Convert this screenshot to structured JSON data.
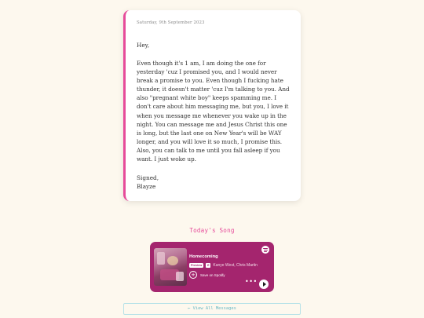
{
  "letter": {
    "date": "Saturday, 9th September 2023",
    "greeting": "Hey,",
    "body": "Even though it's 1 am, I am doing the one for yesterday 'cuz I promised you, and I would never break a promise to you. Even though I fucking hate thunder, it doesn't matter 'cuz I'm talking to you. And also \"pregnant white boy\" keeps spamming me. I don't care about him messaging me, but you, I love it when you message me whenever you wake up in the night. You can message me and Jesus Christ this one is long, but the last one on New Year's will be WAY longer, and you will love it so much, I promise this. Also, you can talk to me until you fall asleep if you want. I just woke up.",
    "signoff": "Signed,",
    "signature": "Blayze"
  },
  "song_section": {
    "heading": "Today's Song"
  },
  "spotify": {
    "track": "Homecoming",
    "preview_badge": "Preview",
    "explicit_badge": "E",
    "artists": "Kanye West, Chris Martin",
    "save_label": "Save on Spotify",
    "add_icon": "+",
    "more_icon": "•••",
    "card_color": "#a4256e"
  },
  "footer": {
    "view_all_label": "← View All Messages"
  },
  "colors": {
    "accent": "#e64b9a",
    "background": "#fdf8ee",
    "link": "#6ab8c4"
  }
}
